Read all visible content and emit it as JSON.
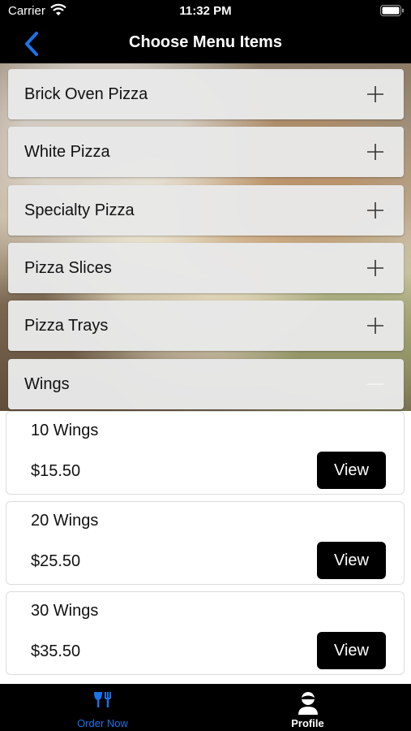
{
  "status_bar": {
    "carrier": "Carrier",
    "time": "11:32 PM"
  },
  "nav": {
    "title": "Choose Menu Items",
    "back_icon": "chevron-left-icon",
    "accent_color": "#1a73e8"
  },
  "categories": [
    {
      "label": "Brick Oven Pizza",
      "state": "collapsed"
    },
    {
      "label": "White Pizza",
      "state": "collapsed"
    },
    {
      "label": "Specialty Pizza",
      "state": "collapsed"
    },
    {
      "label": "Pizza Slices",
      "state": "collapsed"
    },
    {
      "label": "Pizza Trays",
      "state": "collapsed"
    },
    {
      "label": "Wings",
      "state": "expanded"
    }
  ],
  "items": [
    {
      "name": "10 Wings",
      "price": "$15.50",
      "button": "View"
    },
    {
      "name": "20 Wings",
      "price": "$25.50",
      "button": "View"
    },
    {
      "name": "30 Wings",
      "price": "$35.50",
      "button": "View"
    }
  ],
  "tab_bar": {
    "tabs": [
      {
        "label": "Order Now",
        "icon": "utensils-icon",
        "active": true,
        "color": "#1a73e8"
      },
      {
        "label": "Profile",
        "icon": "user-icon",
        "active": false,
        "color": "#ffffff"
      }
    ]
  }
}
